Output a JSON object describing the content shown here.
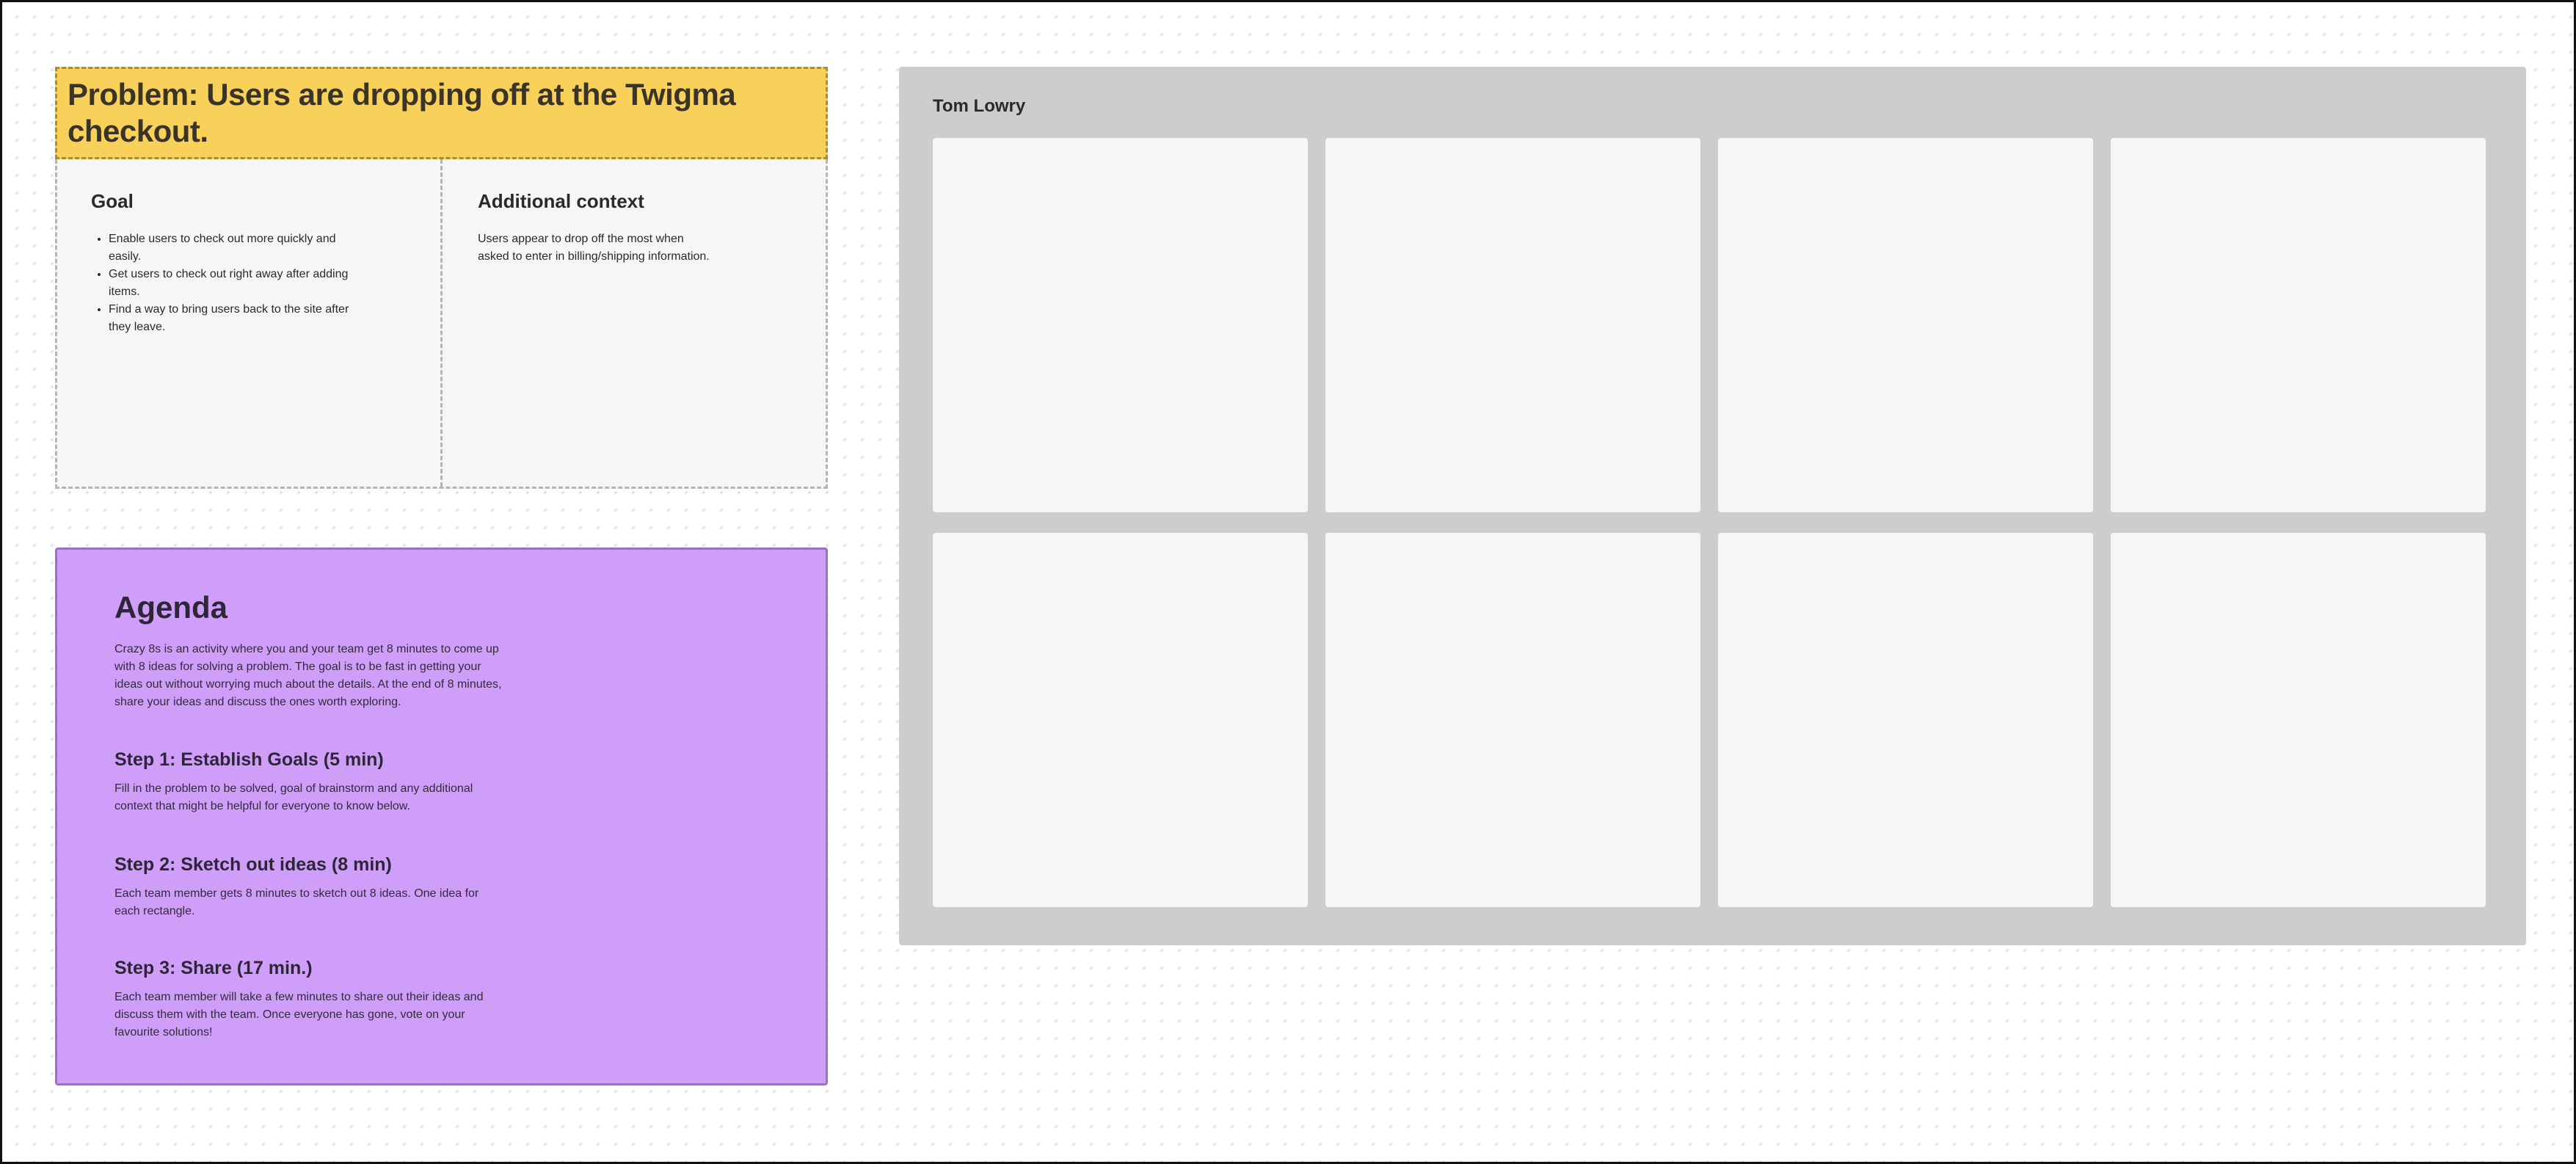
{
  "problem": {
    "title": "Problem: Users are dropping off at the Twigma checkout."
  },
  "goal": {
    "title": "Goal",
    "items": [
      "Enable users to check out more quickly and easily.",
      "Get users to check out right away after adding items.",
      "Find a way to bring users back to the site after they leave."
    ]
  },
  "context": {
    "title": "Additional context",
    "text": "Users appear to drop off the most when asked to enter in billing/shipping information."
  },
  "agenda": {
    "title": "Agenda",
    "intro": "Crazy 8s is an activity where you and your team get 8 minutes to come up with 8 ideas for solving a problem. The goal is to be fast in getting your ideas out without worrying much about the details. At the end of 8 minutes, share your ideas and discuss the ones worth exploring.",
    "steps": [
      {
        "title": "Step 1: Establish Goals (5 min)",
        "text": "Fill in the problem to be solved, goal of brainstorm and any additional context that might be helpful for everyone to know below."
      },
      {
        "title": "Step 2: Sketch out ideas (8 min)",
        "text": "Each team member gets 8 minutes to sketch out 8 ideas. One idea for each rectangle."
      },
      {
        "title": "Step 3: Share (17 min.)",
        "text": "Each team member will take a few minutes to share out their ideas and discuss them with the team. Once everyone has gone, vote on your favourite solutions!"
      }
    ]
  },
  "board": {
    "owner": "Tom Lowry",
    "cells": 8
  },
  "colors": {
    "problem_bg": "#f8d15a",
    "agenda_bg": "#cf9ef9",
    "board_bg": "#cecdce",
    "cell_bg": "#f6f6f6"
  }
}
